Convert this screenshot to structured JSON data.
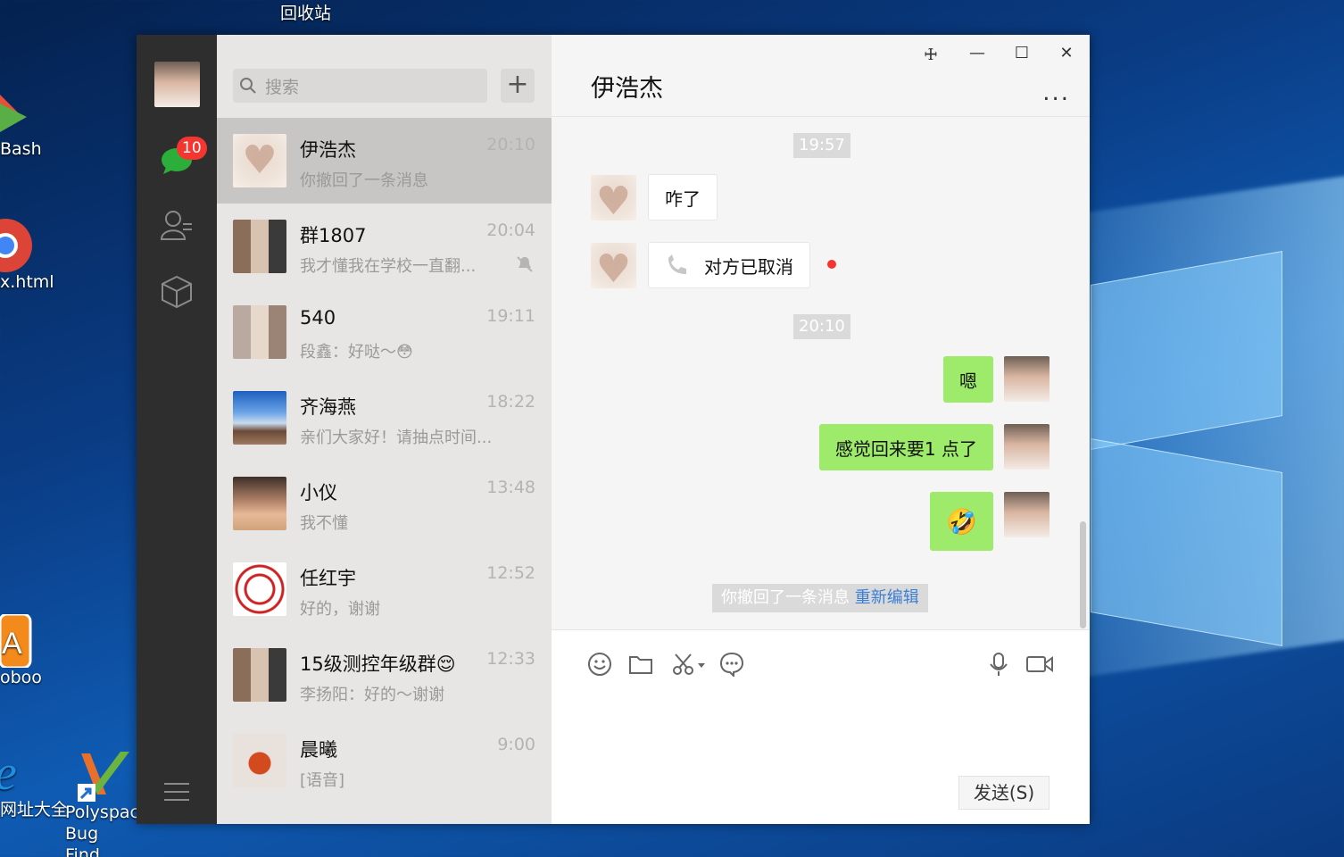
{
  "desktop": {
    "icons": [
      {
        "label": "回收站"
      },
      {
        "label": "Bash"
      },
      {
        "label": "x.html"
      },
      {
        "label": "oboo"
      },
      {
        "label": "网址大全"
      },
      {
        "label": "Polyspace Bug Find..."
      }
    ]
  },
  "sidebar": {
    "unread_badge": "10"
  },
  "chatlist": {
    "search_placeholder": "搜索",
    "add_label": "+",
    "conversations": [
      {
        "name": "伊浩杰",
        "time": "20:10",
        "preview": "你撤回了一条消息"
      },
      {
        "name": "群1807",
        "time": "20:04",
        "preview": "我才懂我在学校一直翻..."
      },
      {
        "name": "540",
        "time": "19:11",
        "preview": "段鑫：好哒～😳"
      },
      {
        "name": "齐海燕",
        "time": "18:22",
        "preview": "亲们大家好！请抽点时间..."
      },
      {
        "name": "小仪",
        "time": "13:48",
        "preview": "我不懂"
      },
      {
        "name": "任红宇",
        "time": "12:52",
        "preview": "好的，谢谢"
      },
      {
        "name": "15级测控年级群😌",
        "time": "12:33",
        "preview": "李扬阳：好的～谢谢"
      },
      {
        "name": "晨曦",
        "time": "9:00",
        "preview": "[语音]"
      }
    ]
  },
  "chat": {
    "title": "伊浩杰",
    "more_label": "...",
    "window_buttons": {
      "pin": "🜊",
      "minimize": "—",
      "maximize": "☐",
      "close": "✕"
    },
    "messages": [
      {
        "type": "time",
        "text": "19:57"
      },
      {
        "type": "in",
        "text": "咋了"
      },
      {
        "type": "in-call",
        "text": "对方已取消"
      },
      {
        "type": "time",
        "text": "20:10"
      },
      {
        "type": "out",
        "text": "嗯"
      },
      {
        "type": "out",
        "text": "感觉回来要1 点了"
      },
      {
        "type": "out-emoji",
        "text": "🤣"
      }
    ],
    "recall_notice": {
      "text": "你撤回了一条消息",
      "link": "重新编辑"
    },
    "send_label": "发送(S)"
  }
}
